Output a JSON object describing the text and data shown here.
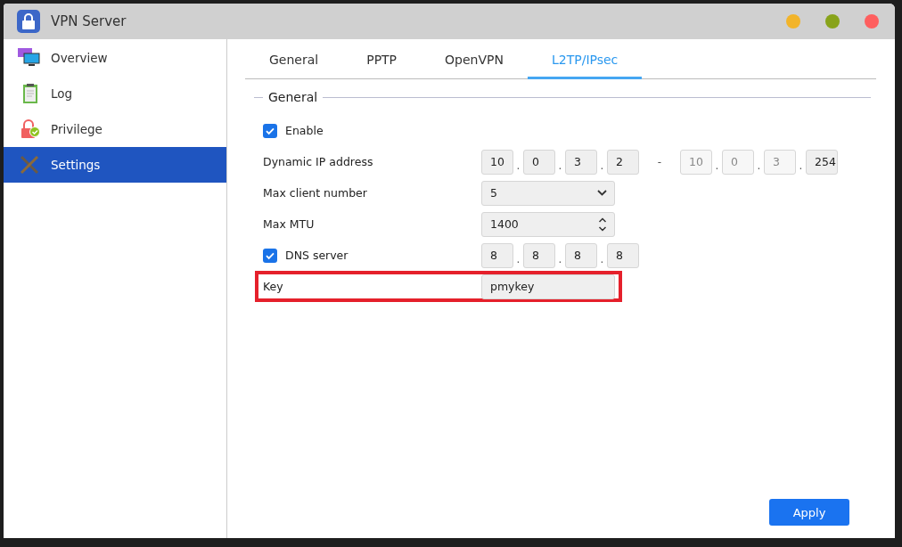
{
  "window": {
    "title": "VPN Server",
    "controls": [
      {
        "color": "#f2b42a"
      },
      {
        "color": "#88a31a"
      },
      {
        "color": "#fe5f5f"
      }
    ]
  },
  "sidebar": {
    "items": [
      {
        "label": "Overview",
        "selected": false
      },
      {
        "label": "Log",
        "selected": false
      },
      {
        "label": "Privilege",
        "selected": false
      },
      {
        "label": "Settings",
        "selected": true
      }
    ]
  },
  "tabs": [
    {
      "label": "General",
      "selected": false
    },
    {
      "label": "PPTP",
      "selected": false
    },
    {
      "label": "OpenVPN",
      "selected": false
    },
    {
      "label": "L2TP/IPsec",
      "selected": true
    }
  ],
  "section": {
    "title": "General",
    "rows": [
      {
        "kind": "checkbox",
        "label": "Enable",
        "checked": true
      },
      {
        "kind": "ip_range",
        "label": "Dynamic IP address",
        "separator": "-",
        "start_dots": [
          ".",
          ".",
          "."
        ],
        "end_dots": [
          ".",
          ".",
          "."
        ],
        "start": [
          {
            "value": "10",
            "disabled": false
          },
          {
            "value": "0",
            "disabled": false
          },
          {
            "value": "3",
            "disabled": false
          },
          {
            "value": "2",
            "disabled": false
          }
        ],
        "end": [
          {
            "value": "10",
            "disabled": true
          },
          {
            "value": "0",
            "disabled": true
          },
          {
            "value": "3",
            "disabled": true
          },
          {
            "value": "254",
            "disabled": false
          }
        ]
      },
      {
        "kind": "select",
        "label": "Max client number",
        "value": "5"
      },
      {
        "kind": "spinner",
        "label": "Max MTU",
        "value": "1400"
      },
      {
        "kind": "checkbox_ip",
        "label": "DNS server",
        "checked": true,
        "dots": [
          ".",
          ".",
          "."
        ],
        "ip": [
          {
            "value": "8",
            "disabled": false
          },
          {
            "value": "8",
            "disabled": false
          },
          {
            "value": "8",
            "disabled": false
          },
          {
            "value": "8",
            "disabled": false
          }
        ]
      },
      {
        "kind": "text",
        "label": "Key",
        "value": "pmykey",
        "highlighted": true
      }
    ]
  },
  "apply_button": "Apply"
}
